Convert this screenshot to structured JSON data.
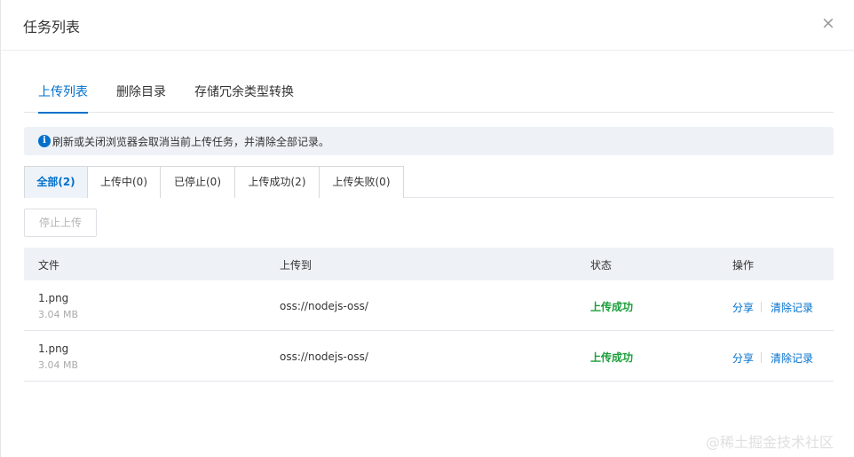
{
  "dialog": {
    "title": "任务列表",
    "close_glyph": "×"
  },
  "tabs": [
    {
      "label": "上传列表"
    },
    {
      "label": "删除目录"
    },
    {
      "label": "存储冗余类型转换"
    }
  ],
  "notice": {
    "icon": "info-icon",
    "text": "刷新或关闭浏览器会取消当前上传任务，并清除全部记录。"
  },
  "filter_tabs": [
    {
      "label": "全部(2)"
    },
    {
      "label": "上传中(0)"
    },
    {
      "label": "已停止(0)"
    },
    {
      "label": "上传成功(2)"
    },
    {
      "label": "上传失败(0)"
    }
  ],
  "toolbar": {
    "stop_label": "停止上传"
  },
  "table": {
    "headers": [
      "文件",
      "上传到",
      "状态",
      "操作"
    ],
    "rows": [
      {
        "file": "1.png",
        "size": "3.04 MB",
        "dest": "oss://nodejs-oss/",
        "status": "上传成功",
        "share": "分享",
        "clear": "清除记录"
      },
      {
        "file": "1.png",
        "size": "3.04 MB",
        "dest": "oss://nodejs-oss/",
        "status": "上传成功",
        "share": "分享",
        "clear": "清除记录"
      }
    ]
  },
  "watermark": "@稀土掘金技术社区",
  "colors": {
    "accent": "#0070cc",
    "success": "#1b9e3a",
    "notice_bg": "#eef1f6"
  }
}
